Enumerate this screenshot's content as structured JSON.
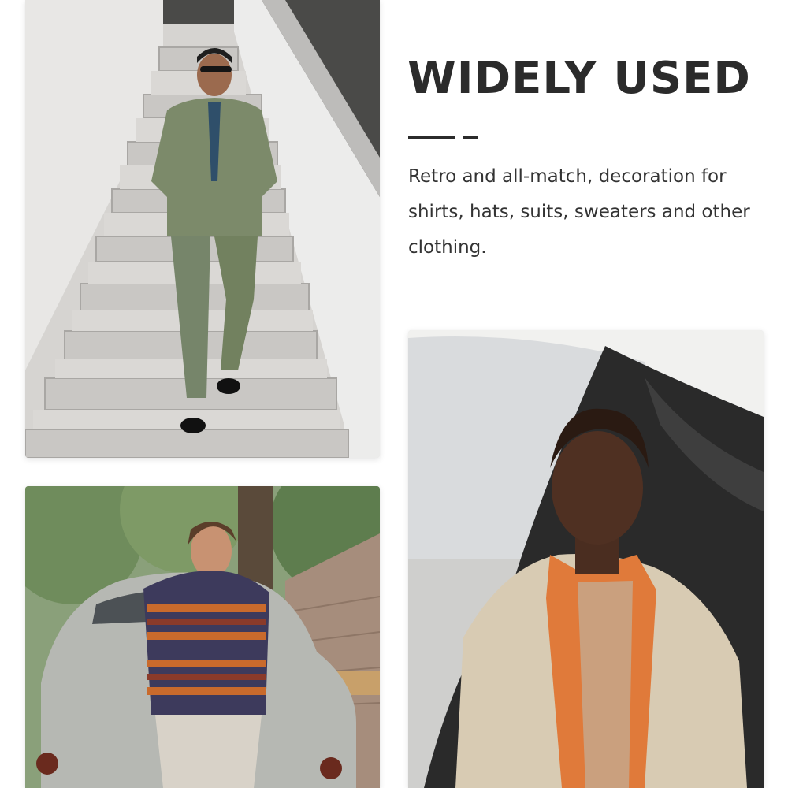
{
  "heading": "WIDELY USED",
  "description": "Retro and all-match, decoration for shirts, hats, suits, sweaters and other clothing.",
  "colors": {
    "text": "#2b2b2b",
    "background": "#ffffff"
  },
  "photos": [
    {
      "name": "man-in-green-suit-on-stairs"
    },
    {
      "name": "man-in-patterned-sweater-on-vintage-car"
    },
    {
      "name": "man-in-orange-shirt-and-beige-coat"
    }
  ]
}
